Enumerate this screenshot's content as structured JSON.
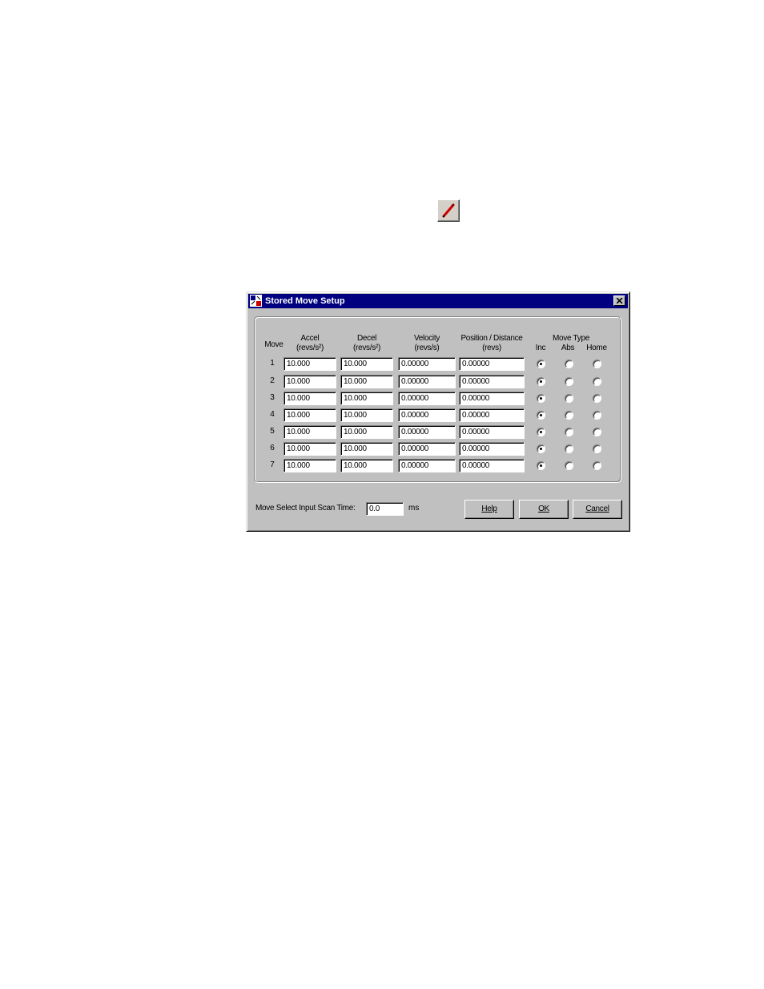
{
  "toolbar": {
    "icon": "pencil-icon"
  },
  "dialog": {
    "title": "Stored Move Setup",
    "icon": "app-icon",
    "close_icon": "close-icon",
    "headers": {
      "move": "Move",
      "accel": [
        "Accel",
        "(revs/s²)"
      ],
      "decel": [
        "Decel",
        "(revs/s²)"
      ],
      "velocity": [
        "Velocity",
        "(revs/s)"
      ],
      "position": [
        "Position / Distance",
        "(revs)"
      ],
      "move_type": "Move Type",
      "inc": "Inc",
      "abs": "Abs",
      "home": "Home"
    },
    "rows": [
      {
        "move": "1",
        "accel": "10.000",
        "decel": "10.000",
        "velocity": "0.00000",
        "position": "0.00000",
        "type": "inc"
      },
      {
        "move": "2",
        "accel": "10.000",
        "decel": "10.000",
        "velocity": "0.00000",
        "position": "0.00000",
        "type": "inc"
      },
      {
        "move": "3",
        "accel": "10.000",
        "decel": "10.000",
        "velocity": "0.00000",
        "position": "0.00000",
        "type": "inc"
      },
      {
        "move": "4",
        "accel": "10.000",
        "decel": "10.000",
        "velocity": "0.00000",
        "position": "0.00000",
        "type": "inc"
      },
      {
        "move": "5",
        "accel": "10.000",
        "decel": "10.000",
        "velocity": "0.00000",
        "position": "0.00000",
        "type": "inc"
      },
      {
        "move": "6",
        "accel": "10.000",
        "decel": "10.000",
        "velocity": "0.00000",
        "position": "0.00000",
        "type": "inc"
      },
      {
        "move": "7",
        "accel": "10.000",
        "decel": "10.000",
        "velocity": "0.00000",
        "position": "0.00000",
        "type": "inc"
      }
    ],
    "scan_time": {
      "label": "Move Select Input Scan Time:",
      "value": "0.0",
      "unit": "ms"
    },
    "buttons": {
      "help": "Help",
      "ok": "OK",
      "cancel": "Cancel"
    }
  }
}
